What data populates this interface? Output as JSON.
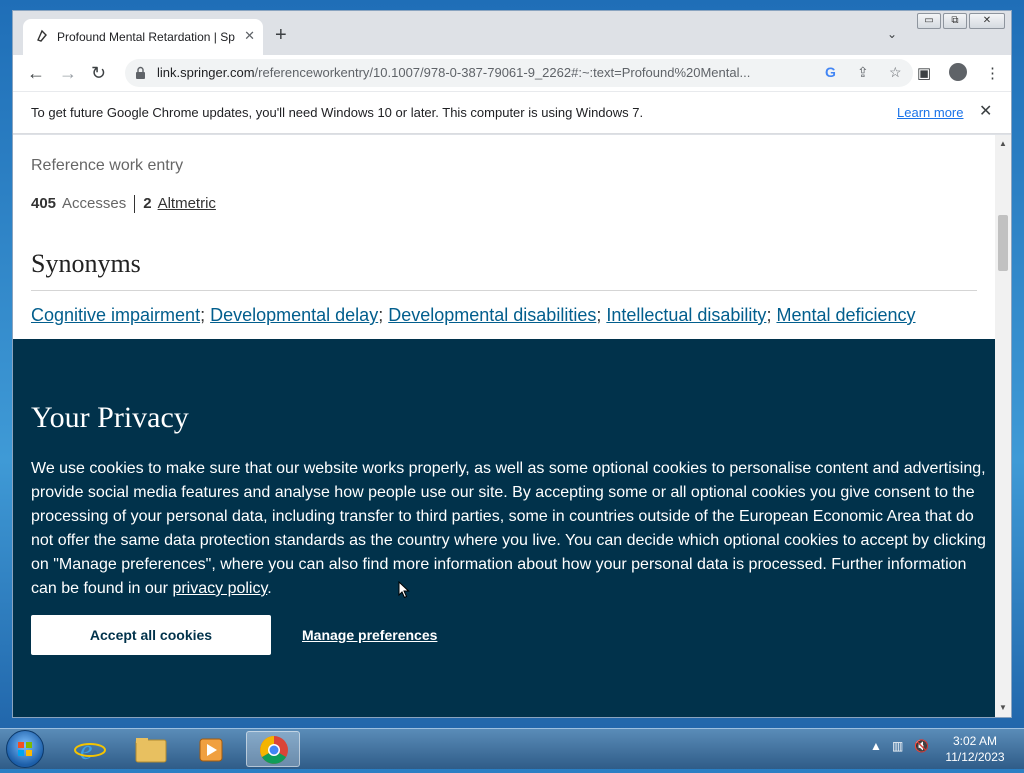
{
  "browser": {
    "tab_title": "Profound Mental Retardation | Sp",
    "url_host": "link.springer.com",
    "url_path": "/referenceworkentry/10.1007/978-0-387-79061-9_2262#:~:text=Profound%20Mental...",
    "window_controls": {
      "minimize": "▭",
      "restore": "⧉",
      "close": "✕"
    }
  },
  "infobar": {
    "message": "To get future Google Chrome updates, you'll need Windows 10 or later. This computer is using Windows 7.",
    "learn_more": "Learn more"
  },
  "page": {
    "ref_type": "Reference work entry",
    "accesses_count": "405",
    "accesses_label": "Accesses",
    "altmetric_count": "2",
    "altmetric_label": "Altmetric",
    "synonyms_heading": "Synonyms",
    "synonyms": [
      "Cognitive impairment",
      "Developmental delay",
      "Developmental disabilities",
      "Intellectual disability",
      "Mental deficiency"
    ]
  },
  "privacy": {
    "title": "Your Privacy",
    "body": "We use cookies to make sure that our website works properly, as well as some optional cookies to personalise content and advertising, provide social media features and analyse how people use our site. By accepting some or all optional cookies you give consent to the processing of your personal data, including transfer to third parties, some in countries outside of the European Economic Area that do not offer the same data protection standards as the country where you live. You can decide which optional cookies to accept by clicking on \"Manage preferences\", where you can also find more information about how your personal data is processed. Further information can be found in our ",
    "policy_link": "privacy policy",
    "body_end": ".",
    "accept_button": "Accept all cookies",
    "manage_button": "Manage preferences"
  },
  "taskbar": {
    "time": "3:02 AM",
    "date": "11/12/2023"
  },
  "colors": {
    "privacy_bg": "#01324b",
    "link": "#025e8d",
    "chrome_link": "#1a73e8"
  }
}
